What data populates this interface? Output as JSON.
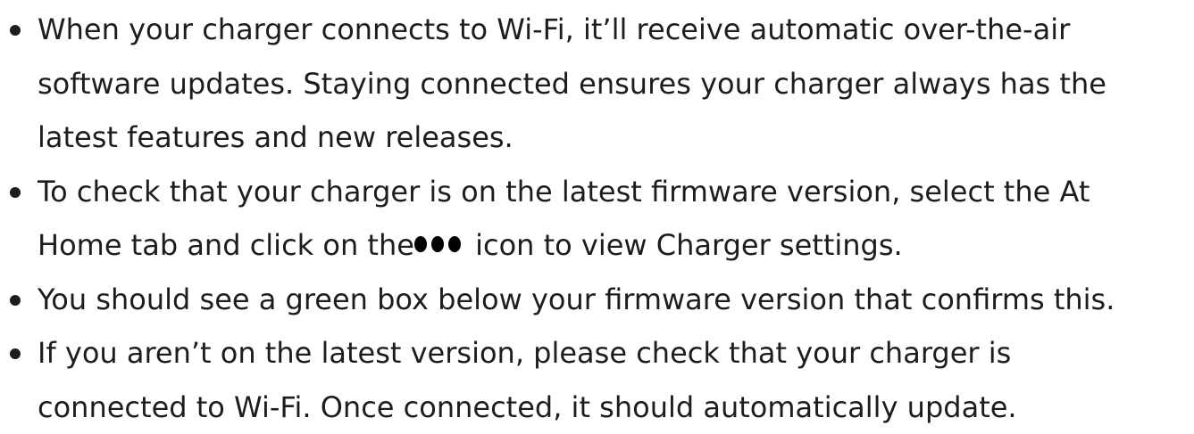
{
  "bullets": [
    {
      "lines": [
        "When your charger connects to Wi-Fi, it’ll receive automatic over-the-air",
        "software updates. Staying connected ensures your charger always has the",
        "latest features and new releases."
      ]
    },
    {
      "line1": "To check that your charger is on the latest firmware version, select the At",
      "line2_before": "Home tab and click on the",
      "icon": "three-dots-icon",
      "line2_after": " icon to view Charger settings."
    },
    {
      "lines": [
        "You should see a green box below your firmware version that confirms this."
      ]
    },
    {
      "lines": [
        "If you aren’t on the latest version, please check that your charger is",
        "connected to Wi-Fi. Once connected, it should automatically update."
      ]
    }
  ]
}
